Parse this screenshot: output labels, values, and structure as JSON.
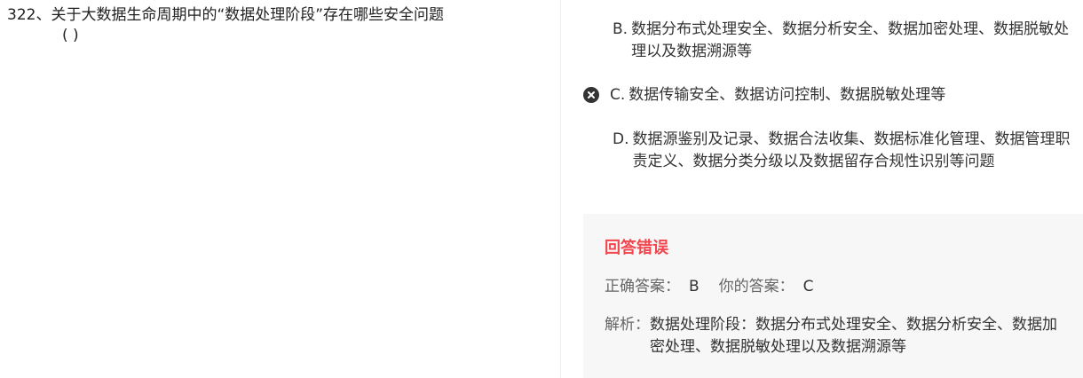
{
  "question": {
    "title": "322、关于大数据生命周期中的“数据处理阶段”存在哪些安全问题",
    "blank": "( )"
  },
  "options": [
    {
      "letter": "B.",
      "text": "数据分布式处理安全、数据分析安全、数据加密处理、数据脱敏处理以及数据溯源等"
    },
    {
      "letter": "C.",
      "text": "数据传输安全、数据访问控制、数据脱敏处理等",
      "marked_wrong": true
    },
    {
      "letter": "D.",
      "text": "数据源鉴别及记录、数据合法收集、数据标准化管理、数据管理职责定义、数据分类分级以及数据留存合规性识别等问题"
    }
  ],
  "result": {
    "status": "回答错误",
    "correct_label": "正确答案：",
    "correct_value": "B",
    "yours_label": "你的答案：",
    "yours_value": "C",
    "analysis_label": "解析：",
    "analysis_text": "数据处理阶段：数据分布式处理安全、数据分析安全、数据加密处理、数据脱敏处理以及数据溯源等"
  },
  "colors": {
    "error": "#f2454d",
    "panel_bg": "#f7f7f7",
    "icon_bg": "#333333"
  },
  "icons": {
    "wrong_mark": "close-circle-icon"
  }
}
